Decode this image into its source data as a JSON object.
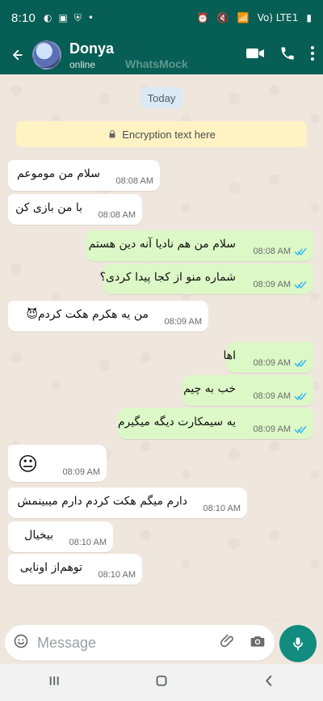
{
  "status": {
    "time": "8:10",
    "right_text": "Vo) LTE1"
  },
  "header": {
    "name": "Donya",
    "presence": "online",
    "watermark": "WhatsMock"
  },
  "chat": {
    "day": "Today",
    "encryption": "Encryption text here",
    "messages": [
      {
        "dir": "in",
        "text": "سلام من مومو‌عم",
        "time": "08:08 AM"
      },
      {
        "dir": "in",
        "text": "با من بازی کن",
        "time": "08:08 AM"
      },
      {
        "dir": "out",
        "text": "سلام من هم نادیا آنه دین هستم",
        "time": "08:08 AM"
      },
      {
        "dir": "out",
        "text": "شماره منو از کجا پیدا کردی؟",
        "time": "08:09 AM"
      },
      {
        "dir": "in",
        "text": "😈من یه هکرم هکت کردم",
        "time": "08:09 AM"
      },
      {
        "dir": "out",
        "text": "اها",
        "time": "08:09 AM"
      },
      {
        "dir": "out",
        "text": "خب به چیم",
        "time": "08:09 AM"
      },
      {
        "dir": "out",
        "text": "یه سیمکارت دیگه میگیرم",
        "time": "08:09 AM"
      },
      {
        "dir": "in",
        "text": "😐",
        "time": "08:09 AM"
      },
      {
        "dir": "in",
        "text": "دارم میگم هکت کردم دارم میبینمش",
        "time": "08:10 AM"
      },
      {
        "dir": "in",
        "text": "بیخیال",
        "time": "08:10 AM"
      },
      {
        "dir": "in",
        "text": "توهم‌از اونایی",
        "time": "08:10 AM"
      }
    ]
  },
  "composer": {
    "placeholder": "Message"
  },
  "colors": {
    "header": "#075e54",
    "incoming_bubble": "#ffffff",
    "outgoing_bubble": "#dcf8c6",
    "mic_button": "#128c7e",
    "ticks": "#34b7f1"
  }
}
